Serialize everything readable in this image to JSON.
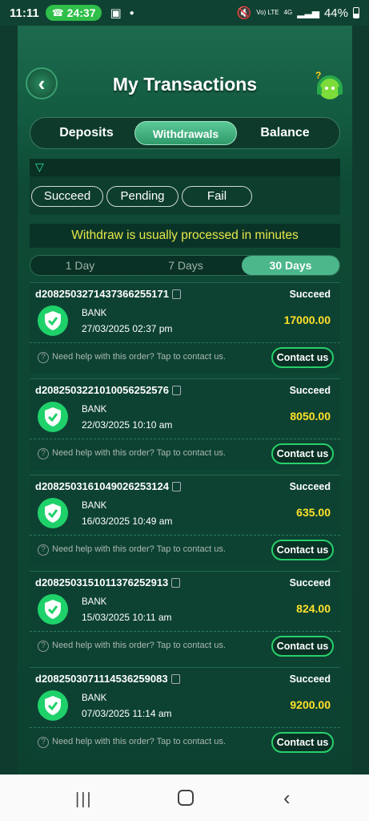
{
  "status_bar": {
    "time": "11:11",
    "call_timer": "24:37",
    "volte": "Vo) LTE",
    "network": "4G",
    "battery": "44%"
  },
  "header": {
    "title": "My Transactions"
  },
  "tabs": [
    {
      "label": "Deposits",
      "active": false
    },
    {
      "label": "Withdrawals",
      "active": true
    },
    {
      "label": "Balance",
      "active": false
    }
  ],
  "filters": [
    "Succeed",
    "Pending",
    "Fail"
  ],
  "notice": "Withdraw is usually processed in minutes",
  "period": [
    {
      "label": "1 Day",
      "active": false
    },
    {
      "label": "7 Days",
      "active": false
    },
    {
      "label": "30 Days",
      "active": true
    }
  ],
  "transactions": [
    {
      "order": "d2082503271437366255171",
      "status": "Succeed",
      "method": "BANK",
      "date": "27/03/2025 02:37 pm",
      "amount": "17000.00"
    },
    {
      "order": "d2082503221010056252576",
      "status": "Succeed",
      "method": "BANK",
      "date": "22/03/2025 10:10 am",
      "amount": "8050.00"
    },
    {
      "order": "d2082503161049026253124",
      "status": "Succeed",
      "method": "BANK",
      "date": "16/03/2025 10:49 am",
      "amount": "635.00"
    },
    {
      "order": "d2082503151011376252913",
      "status": "Succeed",
      "method": "BANK",
      "date": "15/03/2025 10:11 am",
      "amount": "824.00"
    },
    {
      "order": "d2082503071114536259083",
      "status": "Succeed",
      "method": "BANK",
      "date": "07/03/2025 11:14 am",
      "amount": "9200.00"
    }
  ],
  "help_text": "Need help with this order? Tap to contact us.",
  "contact_label": "Contact us",
  "colors": {
    "accent": "#4bb78a",
    "amount": "#ffe12a",
    "success": "#1fd16a"
  }
}
